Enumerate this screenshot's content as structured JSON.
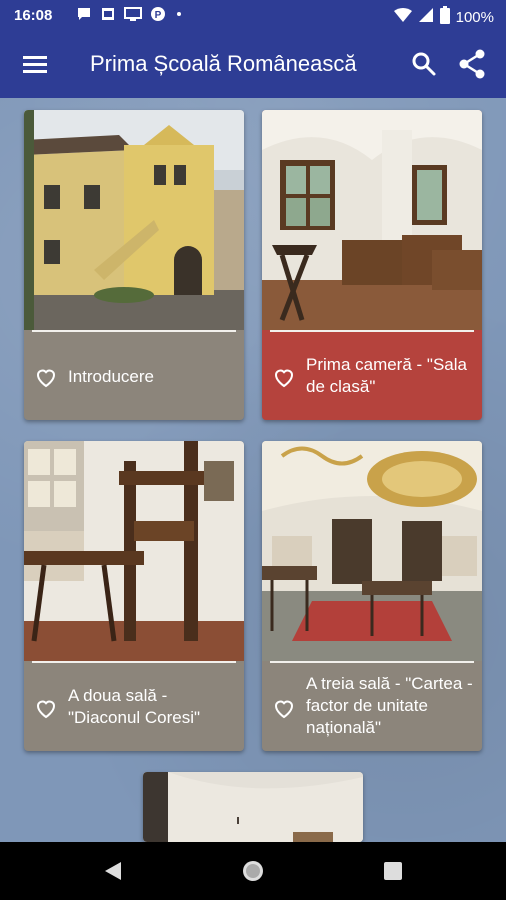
{
  "status_bar": {
    "time": "16:08",
    "battery_text": "100%",
    "icons": [
      "messaging-icon",
      "photo-icon",
      "screen-icon",
      "p-icon",
      "dot-icon",
      "wifi-icon",
      "signal-icon",
      "battery-icon"
    ]
  },
  "app_bar": {
    "title": "Prima Școală Românească",
    "menu_icon": "hamburger-menu-icon",
    "search_icon": "search-icon",
    "share_icon": "share-icon",
    "color": "#2e3d95"
  },
  "cards": [
    {
      "label": "Introducere",
      "highlighted": false
    },
    {
      "label": "Prima cameră - \"Sala de clasă\"",
      "highlighted": true
    },
    {
      "label": "A doua sală - \"Diaconul Coresi\"",
      "highlighted": false
    },
    {
      "label": "A treia sală - \"Cartea - factor de unitate națională\"",
      "highlighted": false
    }
  ],
  "colors": {
    "card_default": "#8c857b",
    "card_highlighted": "#b5433d",
    "background": "#7f97b8"
  },
  "nav_bar": {
    "back_icon": "back-triangle-icon",
    "home_icon": "home-circle-icon",
    "recents_icon": "recents-square-icon"
  }
}
